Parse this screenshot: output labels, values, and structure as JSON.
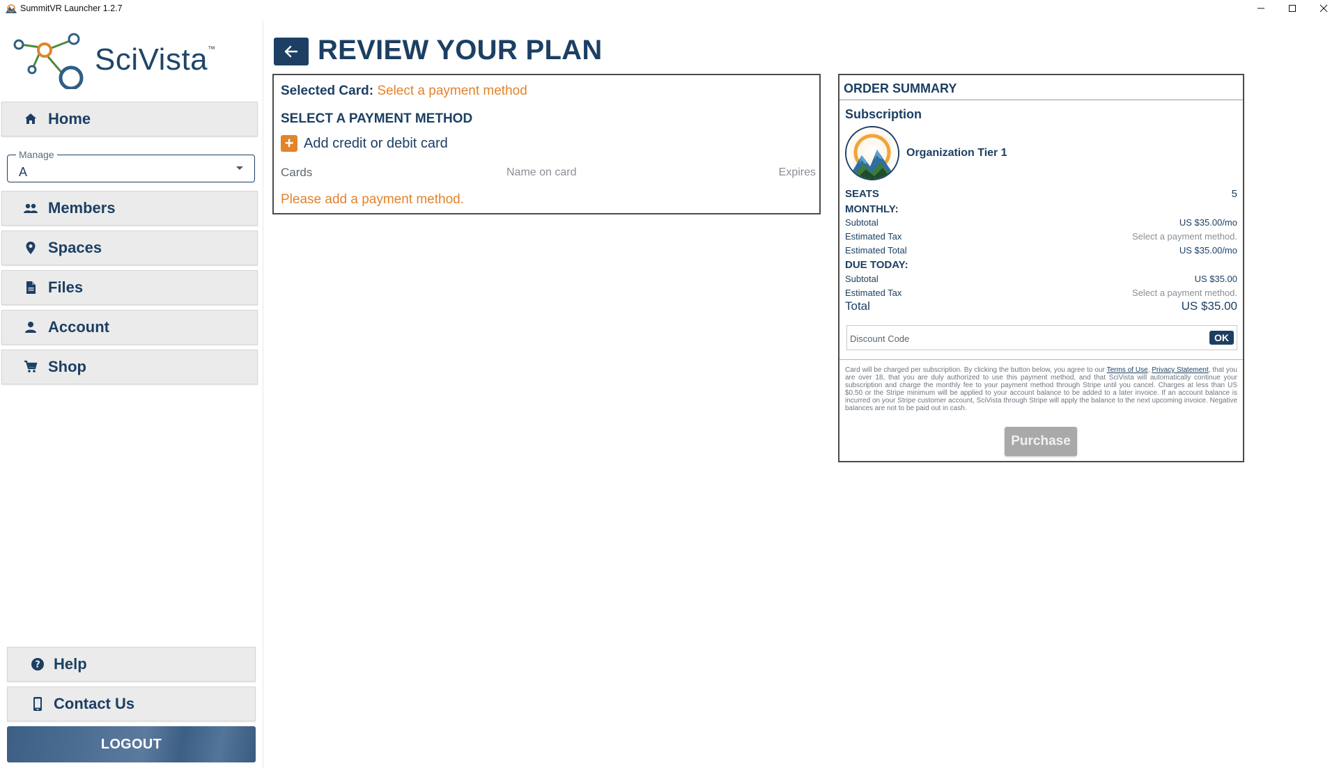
{
  "window": {
    "title": "SummitVR Launcher 1.2.7",
    "controls": [
      "minimize",
      "maximize",
      "close"
    ]
  },
  "brand": {
    "logo_text": "SciVista",
    "trademark": "™",
    "primary_color": "#1c3f63",
    "accent_color": "#e3832a"
  },
  "sidebar": {
    "home_label": "Home",
    "manage": {
      "legend": "Manage",
      "value": "A"
    },
    "items": [
      {
        "label": "Members",
        "icon": "people-icon"
      },
      {
        "label": "Spaces",
        "icon": "location-pin-icon"
      },
      {
        "label": "Files",
        "icon": "file-icon"
      },
      {
        "label": "Account",
        "icon": "person-icon"
      },
      {
        "label": "Shop",
        "icon": "cart-icon"
      }
    ],
    "help_label": "Help",
    "contact_label": "Contact Us",
    "logout_label": "LOGOUT"
  },
  "main": {
    "title": "REVIEW YOUR PLAN",
    "payment": {
      "selected_card_label": "Selected Card:",
      "selected_card_value": "Select a payment method",
      "section_title": "SELECT A PAYMENT METHOD",
      "add_card_label": "Add credit or debit card",
      "columns": [
        "Cards",
        "Name on card",
        "Expires"
      ],
      "empty_message": "Please add a payment method."
    },
    "order_summary": {
      "title": "ORDER SUMMARY",
      "subscription_label": "Subscription",
      "tier_name": "Organization Tier 1",
      "seats_label": "SEATS",
      "seats_value": "5",
      "monthly_label": "MONTHLY:",
      "monthly": {
        "subtotal_label": "Subtotal",
        "subtotal_value": "US $35.00/mo",
        "tax_label": "Estimated Tax",
        "tax_value": "Select a payment method.",
        "total_label": "Estimated Total",
        "total_value": "US $35.00/mo"
      },
      "due_today_label": "DUE TODAY:",
      "due_today": {
        "subtotal_label": "Subtotal",
        "subtotal_value": "US $35.00",
        "tax_label": "Estimated Tax",
        "tax_value": "Select a payment method.",
        "total_label": "Total",
        "total_value": "US $35.00"
      },
      "discount_placeholder": "Discount Code",
      "discount_ok": "OK",
      "legal_prefix": "Card will be charged per subscription. By clicking the button below, you agree to our ",
      "legal_link_terms": "Terms of Use",
      "legal_link_sep": ", ",
      "legal_link_privacy": "Privacy Statement",
      "legal_suffix": ", that you are over 18, that you are duly authorized to use this payment method, and that SciVista will automatically continue your subscription and charge the monthly fee to your payment method through Stripe until you cancel. Charges at less than US $0.50 or the Stripe minimum will be applied to your account balance to be added to a later invoice. If an account balance is incurred on your Stripe customer account, SciVista through Stripe will apply the balance to the next upcoming invoice. Negative balances are not to be paid out in cash.",
      "purchase_label": "Purchase"
    }
  }
}
